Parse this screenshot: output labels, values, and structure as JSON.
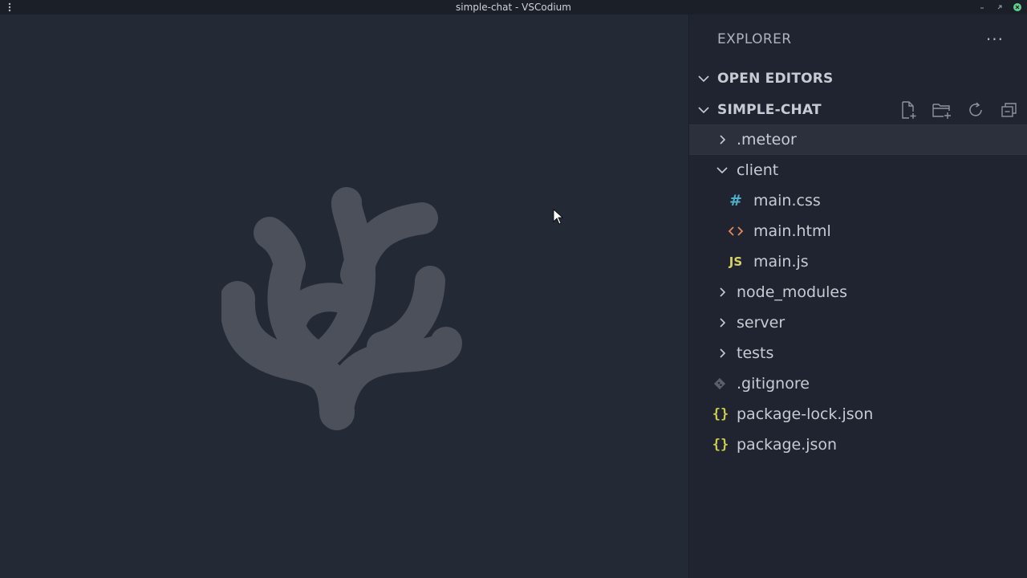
{
  "window": {
    "title": "simple-chat - VSCodium"
  },
  "sidebar": {
    "header": "EXPLORER",
    "more_label": "···",
    "sections": {
      "open_editors": "OPEN EDITORS",
      "project": "SIMPLE-CHAT"
    },
    "tree": [
      {
        "label": ".meteor",
        "type": "folder",
        "expanded": false,
        "depth": 0,
        "selected": true
      },
      {
        "label": "client",
        "type": "folder",
        "expanded": true,
        "depth": 0
      },
      {
        "label": "main.css",
        "type": "file",
        "icon": "hash-icon",
        "depth": 1
      },
      {
        "label": "main.html",
        "type": "file",
        "icon": "html-icon",
        "depth": 1
      },
      {
        "label": "main.js",
        "type": "file",
        "icon": "js-icon",
        "depth": 1
      },
      {
        "label": "node_modules",
        "type": "folder",
        "expanded": false,
        "depth": 0
      },
      {
        "label": "server",
        "type": "folder",
        "expanded": false,
        "depth": 0
      },
      {
        "label": "tests",
        "type": "folder",
        "expanded": false,
        "depth": 0
      },
      {
        "label": ".gitignore",
        "type": "file",
        "icon": "git-icon",
        "depth": 0
      },
      {
        "label": "package-lock.json",
        "type": "file",
        "icon": "json-icon",
        "depth": 0
      },
      {
        "label": "package.json",
        "type": "file",
        "icon": "json-icon",
        "depth": 0
      }
    ]
  },
  "icons": {
    "hash": "#",
    "js": "JS",
    "brace": "{}"
  },
  "colors": {
    "editor_bg": "#242936",
    "sidebar_bg": "#1f2430",
    "css_icon": "#4fb0c9",
    "html_icon": "#e0895a",
    "js_icon": "#d8d064",
    "json_icon": "#c9cc4d",
    "close_button": "#5fd38d"
  }
}
